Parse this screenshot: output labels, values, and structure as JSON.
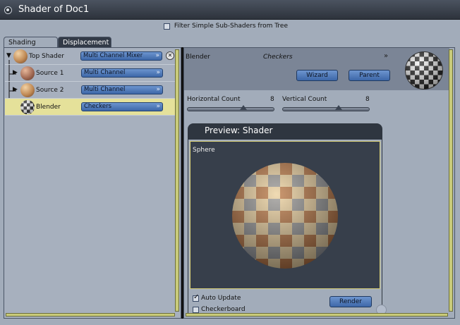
{
  "window": {
    "title": "Shader of Doc1"
  },
  "filter": {
    "label": "Filter Simple Sub-Shaders from Tree",
    "checked": false
  },
  "tabs": [
    {
      "label": "Shading",
      "active": true
    },
    {
      "label": "Displacement",
      "active": false
    }
  ],
  "tree": [
    {
      "label": "Top Shader",
      "shader": "Multi Channel Mixer"
    },
    {
      "label": "Source 1",
      "shader": "Multi Channel"
    },
    {
      "label": "Source 2",
      "shader": "Multi Channel"
    },
    {
      "label": "Blender",
      "shader": "Checkers",
      "selected": true
    }
  ],
  "detail": {
    "name": "Blender",
    "shader": "Checkers",
    "wizard_label": "Wizard",
    "parent_label": "Parent",
    "horizontal": {
      "label": "Horizontal Count",
      "value": "8"
    },
    "vertical": {
      "label": "Vertical Count",
      "value": "8"
    }
  },
  "preview": {
    "title": "Preview: Shader",
    "object": "Sphere",
    "auto_update_label": "Auto Update",
    "auto_update_checked": true,
    "checkerboard_label": "Checkerboard",
    "checkerboard_checked": false,
    "render_label": "Render"
  },
  "colors": {
    "panel_bg": "#a2acba",
    "titlebar": "#2d333c",
    "button_blue": "#4f7bbd",
    "selection": "#e5e19a",
    "scroll_track": "#c9cb7a",
    "render_bg": "#373f4b"
  }
}
